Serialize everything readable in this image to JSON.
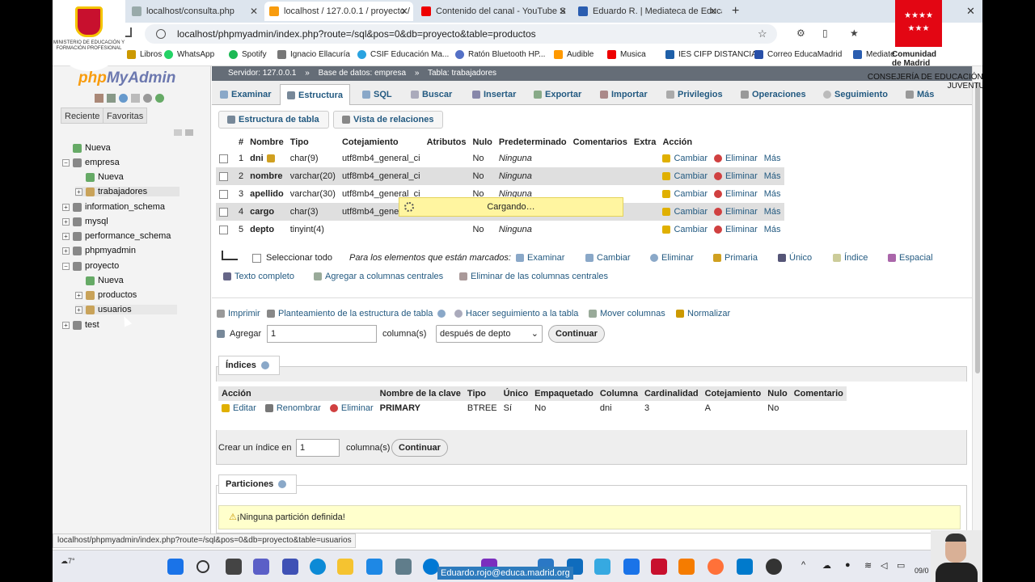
{
  "browser": {
    "tabs": [
      {
        "title": "localhost/consulta.php",
        "active": false
      },
      {
        "title": "localhost / 127.0.0.1 / proyecto /",
        "active": true
      },
      {
        "title": "Contenido del canal - YouTube S",
        "active": false
      },
      {
        "title": "Eduardo R. | Mediateca de Educa",
        "active": false
      }
    ],
    "new_tab": "+",
    "close_window": "✕",
    "url": "localhost/phpmyadmin/index.php?route=/sql&pos=0&db=proyecto&table=productos",
    "bookmarks": [
      "Libros",
      "WhatsApp",
      "Spotify",
      "Ignacio Ellacuría",
      "CSIF Educación Ma...",
      "Ratón Bluetooth HP...",
      "Audible",
      "Musica",
      "IES CIFP DISTANCIA...",
      "Correo EducaMadrid",
      "Mediate"
    ]
  },
  "overlays": {
    "ministerio": "MINISTERIO DE EDUCACIÓN Y FORMACIÓN PROFESIONAL",
    "cm_name": "Comunidad de Madrid",
    "cm_dept": "CONSEJERÍA DE EDUCACIÓN Y JUVENTUD",
    "email": "Eduardo.rojo@educa.madrid.org"
  },
  "sidebar": {
    "logo_a": "php",
    "logo_b": "MyAdmin",
    "tabs": [
      "Reciente",
      "Favoritas"
    ],
    "tree": [
      {
        "label": "Nueva",
        "level": 0
      },
      {
        "label": "empresa",
        "level": 0
      },
      {
        "label": "Nueva",
        "level": 1
      },
      {
        "label": "trabajadores",
        "level": 1
      },
      {
        "label": "information_schema",
        "level": 0
      },
      {
        "label": "mysql",
        "level": 0
      },
      {
        "label": "performance_schema",
        "level": 0
      },
      {
        "label": "phpmyadmin",
        "level": 0
      },
      {
        "label": "proyecto",
        "level": 0
      },
      {
        "label": "Nueva",
        "level": 1
      },
      {
        "label": "productos",
        "level": 1
      },
      {
        "label": "usuarios",
        "level": 1
      },
      {
        "label": "test",
        "level": 0
      }
    ]
  },
  "breadcrumb": {
    "server": "Servidor: 127.0.0.1",
    "db": "Base de datos: empresa",
    "table": "Tabla: trabajadores",
    "sep": "»"
  },
  "menu_tabs": [
    "Examinar",
    "Estructura",
    "SQL",
    "Buscar",
    "Insertar",
    "Exportar",
    "Importar",
    "Privilegios",
    "Operaciones",
    "Seguimiento",
    "Más"
  ],
  "sub_tabs": [
    "Estructura de tabla",
    "Vista de relaciones"
  ],
  "columns_table": {
    "headers": [
      "#",
      "Nombre",
      "Tipo",
      "Cotejamiento",
      "Atributos",
      "Nulo",
      "Predeterminado",
      "Comentarios",
      "Extra",
      "Acción"
    ],
    "rows": [
      {
        "n": "1",
        "name": "dni",
        "type": "char(9)",
        "coll": "utf8mb4_general_ci",
        "null": "No",
        "default": "Ninguna"
      },
      {
        "n": "2",
        "name": "nombre",
        "type": "varchar(20)",
        "coll": "utf8mb4_general_ci",
        "null": "No",
        "default": "Ninguna"
      },
      {
        "n": "3",
        "name": "apellido",
        "type": "varchar(30)",
        "coll": "utf8mb4_general_ci",
        "null": "No",
        "default": "Ninguna"
      },
      {
        "n": "4",
        "name": "cargo",
        "type": "char(3)",
        "coll": "utf8mb4_general_",
        "null": "No",
        "default": "Ninguna"
      },
      {
        "n": "5",
        "name": "depto",
        "type": "tinyint(4)",
        "coll": "",
        "null": "No",
        "default": "Ninguna"
      }
    ],
    "actions": [
      "Cambiar",
      "Eliminar",
      "Más"
    ]
  },
  "loading": "Cargando…",
  "bulk": {
    "select_all": "Seleccionar todo",
    "marked": "Para los elementos que están marcados:",
    "actions": [
      "Examinar",
      "Cambiar",
      "Eliminar",
      "Primaria",
      "Único",
      "Índice",
      "Espacial",
      "Texto completo",
      "Agregar a columnas centrales",
      "Eliminar de las columnas centrales"
    ]
  },
  "tools": [
    "Imprimir",
    "Planteamiento de la estructura de tabla",
    "Hacer seguimiento a la tabla",
    "Mover columnas",
    "Normalizar"
  ],
  "add_column": {
    "label": "Agregar",
    "value": "1",
    "unit": "columna(s)",
    "position": "después de depto",
    "button": "Continuar"
  },
  "indexes": {
    "legend": "Índices",
    "headers": [
      "Acción",
      "Nombre de la clave",
      "Tipo",
      "Único",
      "Empaquetado",
      "Columna",
      "Cardinalidad",
      "Cotejamiento",
      "Nulo",
      "Comentario"
    ],
    "row": {
      "edit": "Editar",
      "rename": "Renombrar",
      "delete": "Eliminar",
      "key": "PRIMARY",
      "type": "BTREE",
      "unique": "Sí",
      "packed": "No",
      "column": "dni",
      "cardinality": "3",
      "collation": "A",
      "null": "No",
      "comment": ""
    },
    "create_label": "Crear un índice en",
    "create_value": "1",
    "create_unit": "columna(s)",
    "create_button": "Continuar"
  },
  "partitions": {
    "legend": "Particiones",
    "note": "¡Ninguna partición definida!"
  },
  "status_url": "localhost/phpmyadmin/index.php?route=/sql&pos=0&db=proyecto&table=usuarios",
  "taskbar": {
    "weather": "7°",
    "clock": "09/0"
  }
}
